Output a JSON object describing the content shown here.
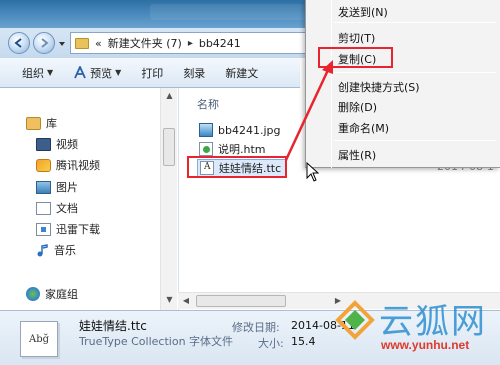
{
  "address_bar": {
    "crumbs": [
      "«",
      "新建文件夹 (7)",
      "bb4241"
    ]
  },
  "toolbar": {
    "items": [
      {
        "label": "组织",
        "has_caret": true
      },
      {
        "label": "预览",
        "has_caret": true
      },
      {
        "label": "打印"
      },
      {
        "label": "刻录"
      },
      {
        "label": "新建文"
      }
    ]
  },
  "nav_pane": {
    "items": [
      {
        "label": "库",
        "icon": "library-icon"
      },
      {
        "label": "视频",
        "icon": "video-icon"
      },
      {
        "label": "腾讯视频",
        "icon": "tencent-video-icon"
      },
      {
        "label": "图片",
        "icon": "pictures-icon"
      },
      {
        "label": "文档",
        "icon": "documents-icon"
      },
      {
        "label": "迅雷下载",
        "icon": "download-icon"
      },
      {
        "label": "音乐",
        "icon": "music-icon"
      },
      {
        "label": "家庭组",
        "icon": "homegroup-icon"
      }
    ]
  },
  "file_pane": {
    "column_header": "名称",
    "files": [
      {
        "name": "bb4241.jpg",
        "icon": "jpg-file-icon"
      },
      {
        "name": "说明.htm",
        "icon": "htm-file-icon"
      },
      {
        "name": "娃娃情结.ttc",
        "icon": "font-file-icon",
        "selected": true
      }
    ],
    "ghost_date": "2014-08-1"
  },
  "context_menu": {
    "items": [
      {
        "label": "发送到(N)"
      },
      {
        "label": "剪切(T)"
      },
      {
        "label": "复制(C)",
        "highlighted": true
      },
      {
        "label": "创建快捷方式(S)"
      },
      {
        "label": "删除(D)"
      },
      {
        "label": "重命名(M)"
      },
      {
        "label": "属性(R)"
      }
    ]
  },
  "details": {
    "thumb_text": "Abğ",
    "name": "娃娃情结.ttc",
    "type": "TrueType Collection 字体文件",
    "modified_label": "修改日期:",
    "modified_value": "2014-08-11",
    "size_label": "大小:",
    "size_value": "15.4"
  },
  "watermark": {
    "brand": "云狐网",
    "url": "www.yunhu.net"
  },
  "colors": {
    "annotation_red": "#e8242f",
    "selection_bg": "#dbe9fb",
    "title_blue": "#2e6fa3"
  }
}
